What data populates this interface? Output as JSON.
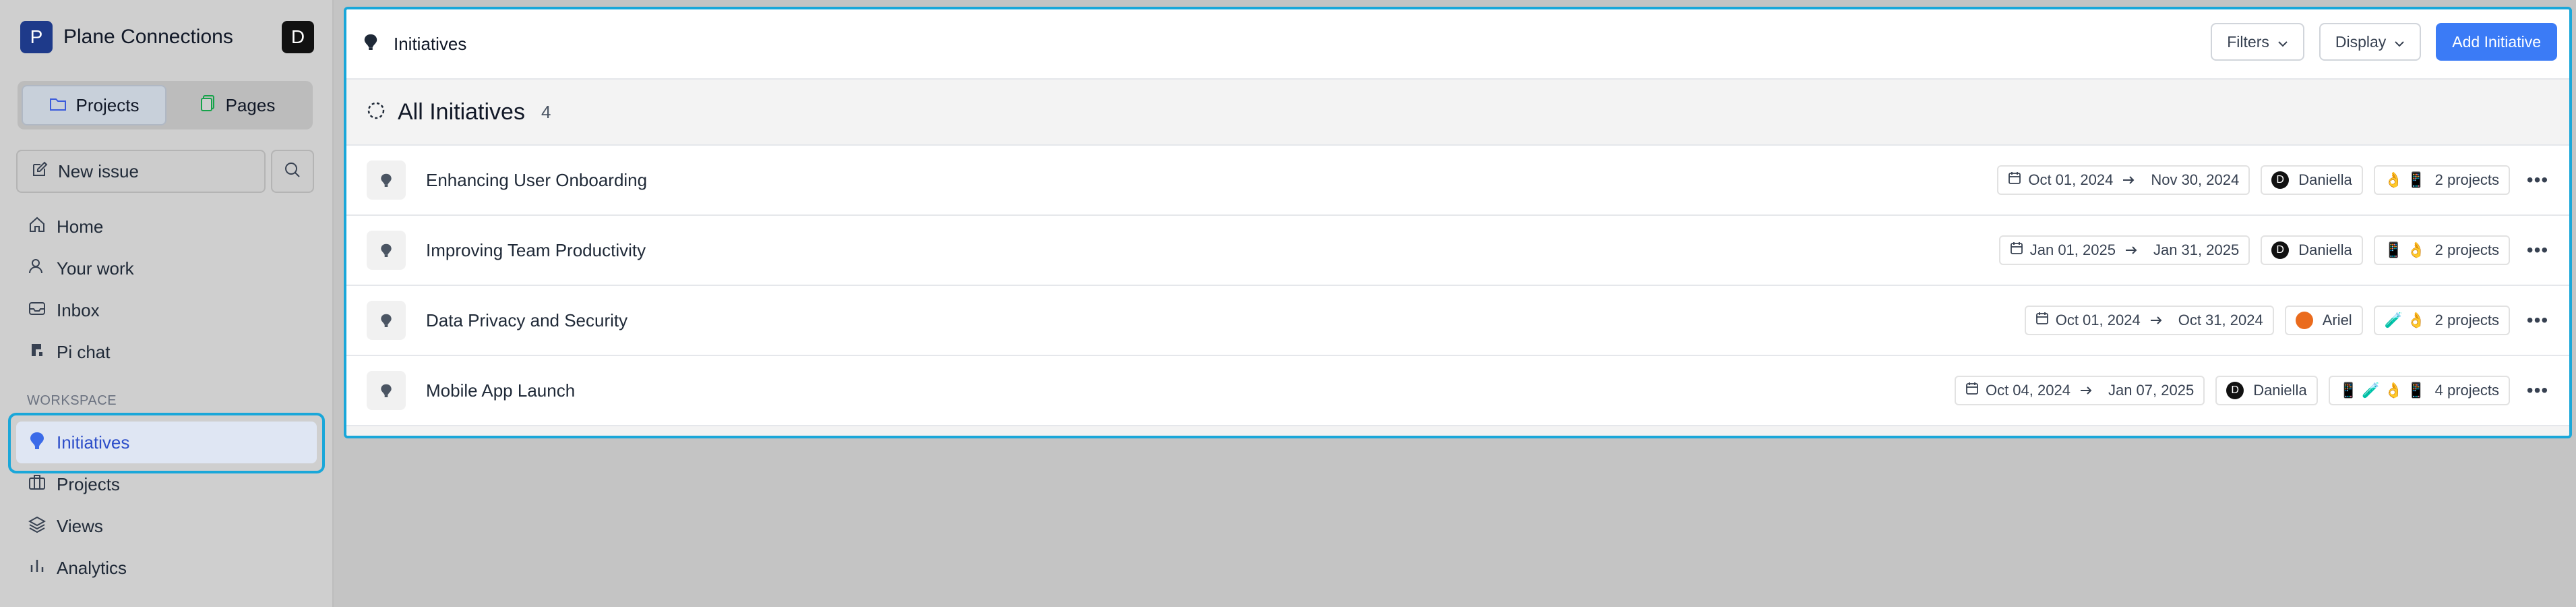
{
  "workspace": {
    "logo_letter": "P",
    "name": "Plane Connections",
    "user_initial": "D"
  },
  "sidebar": {
    "tabs": [
      {
        "label": "Projects"
      },
      {
        "label": "Pages"
      }
    ],
    "new_issue_label": "New issue",
    "primary_nav": [
      {
        "label": "Home",
        "icon": "home-icon"
      },
      {
        "label": "Your work",
        "icon": "user-icon"
      },
      {
        "label": "Inbox",
        "icon": "inbox-icon"
      },
      {
        "label": "Pi chat",
        "icon": "pi-icon"
      }
    ],
    "section_label": "WORKSPACE",
    "workspace_nav": [
      {
        "label": "Initiatives",
        "icon": "initiative-icon",
        "active": true
      },
      {
        "label": "Projects",
        "icon": "briefcase-icon"
      },
      {
        "label": "Views",
        "icon": "layers-icon"
      },
      {
        "label": "Analytics",
        "icon": "chart-icon"
      }
    ]
  },
  "header": {
    "title": "Initiatives",
    "filters_label": "Filters",
    "display_label": "Display",
    "add_label": "Add Initiative"
  },
  "group": {
    "title": "All Initiatives",
    "count": "4"
  },
  "initiatives": [
    {
      "name": "Enhancing User Onboarding",
      "start": "Oct 01, 2024",
      "end": "Nov 30, 2024",
      "lead": "Daniella",
      "lead_initial": "D",
      "projects_emojis": "👌 📱",
      "projects": "2 projects"
    },
    {
      "name": "Improving Team Productivity",
      "start": "Jan 01, 2025",
      "end": "Jan 31, 2025",
      "lead": "Daniella",
      "lead_initial": "D",
      "projects_emojis": "📱 👌",
      "projects": "2 projects"
    },
    {
      "name": "Data Privacy and Security",
      "start": "Oct 01, 2024",
      "end": "Oct 31, 2024",
      "lead": "Ariel",
      "lead_initial": "",
      "projects_emojis": "🧪 👌",
      "projects": "2 projects"
    },
    {
      "name": "Mobile App Launch",
      "start": "Oct 04, 2024",
      "end": "Jan 07, 2025",
      "lead": "Daniella",
      "lead_initial": "D",
      "projects_emojis": "📱 🧪 👌 📱",
      "projects": "4 projects"
    }
  ],
  "colors": {
    "accent": "#3b7bf6",
    "focus_ring": "#1aa7d9",
    "active_nav_text": "#2d4ec9"
  }
}
